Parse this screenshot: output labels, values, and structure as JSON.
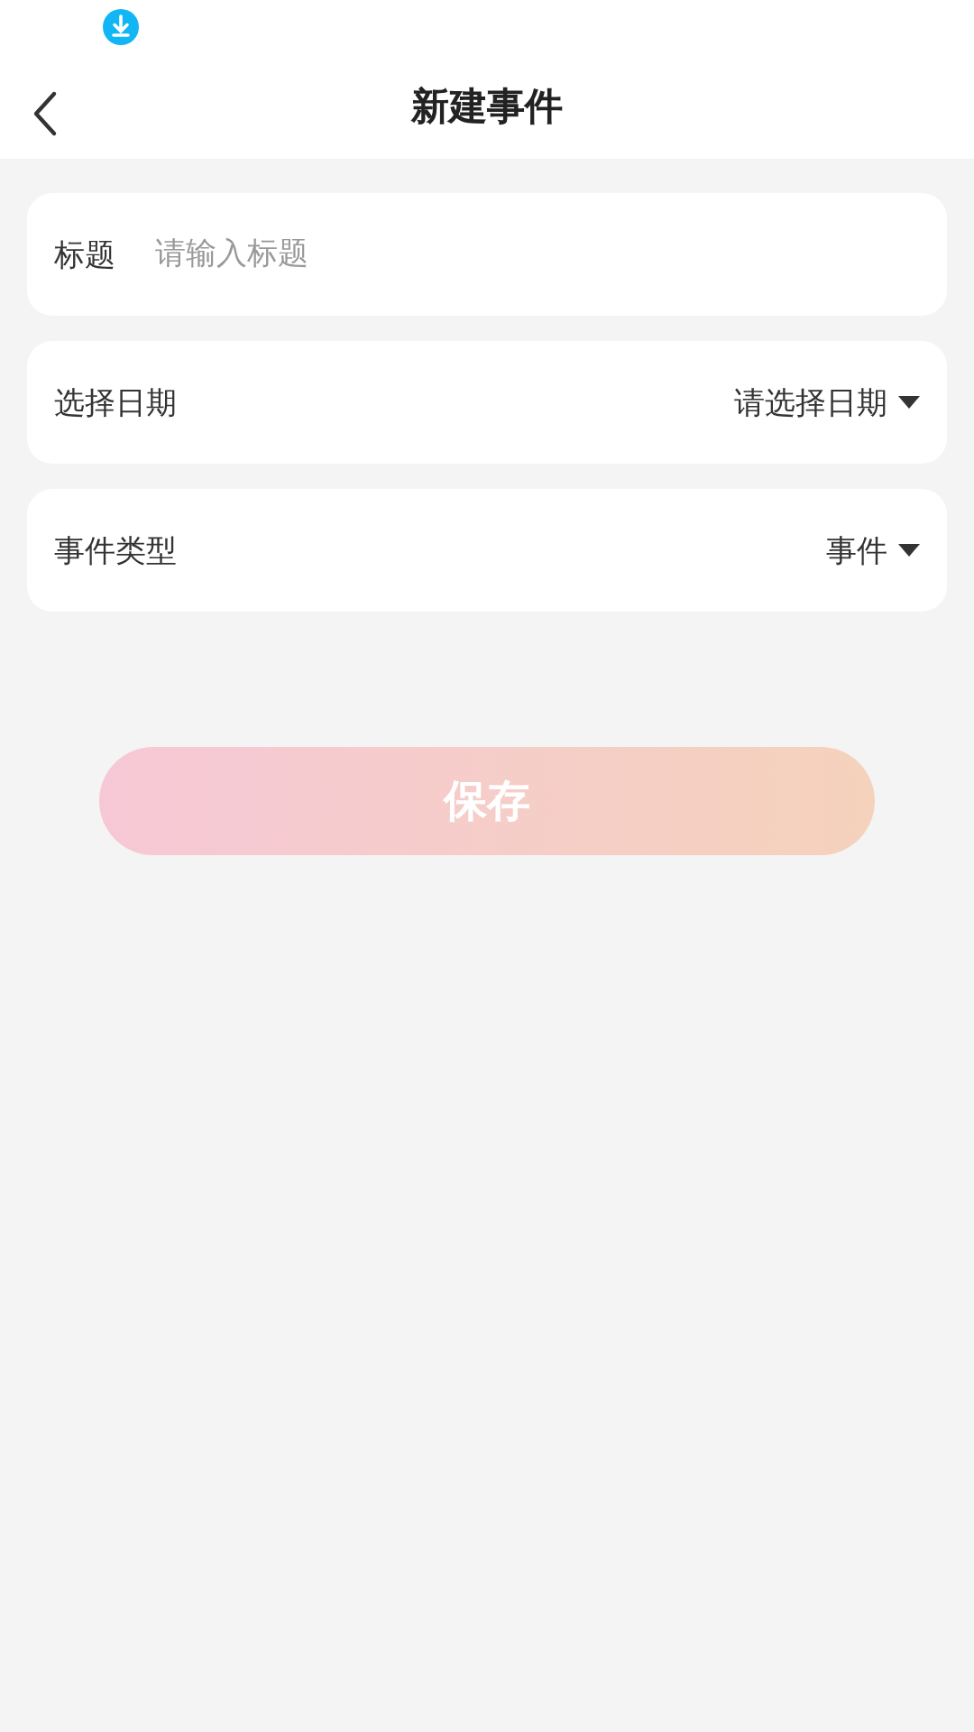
{
  "header": {
    "title": "新建事件"
  },
  "fields": [
    {
      "kind": "input",
      "label": "标题",
      "placeholder": "请输入标题"
    },
    {
      "kind": "select",
      "label": "选择日期",
      "value": "请选择日期"
    },
    {
      "kind": "select",
      "label": "事件类型",
      "value": "事件"
    }
  ],
  "save_button": {
    "label": "保存"
  }
}
